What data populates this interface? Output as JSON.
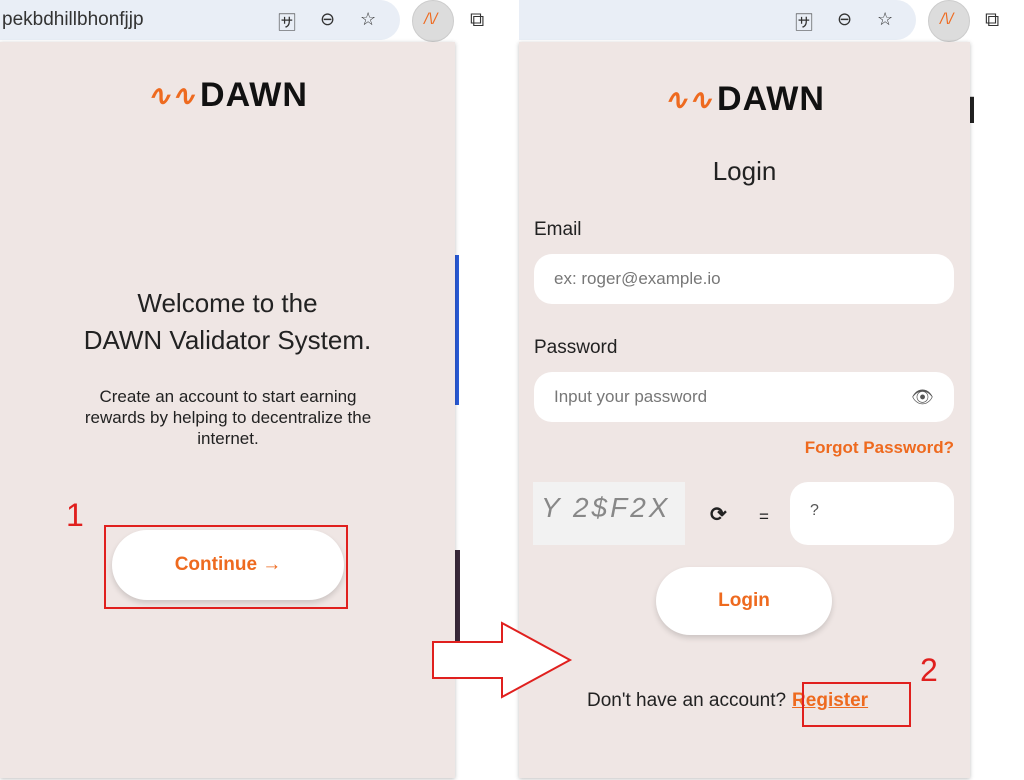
{
  "browser": {
    "url_fragment": "pekbdhillbhonfjjp",
    "icons": [
      "translate-icon",
      "zoom-out-icon",
      "star-icon",
      "dawn-extension-icon",
      "extensions-puzzle-icon"
    ]
  },
  "welcome": {
    "brand": "DAWN",
    "title_line1": "Welcome to the",
    "title_line2": "DAWN Validator System.",
    "description": "Create an account to start earning rewards by helping to decentralize the internet.",
    "continue_label": "Continue →"
  },
  "login": {
    "brand": "DAWN",
    "title": "Login",
    "email_label": "Email",
    "email_placeholder": "ex: roger@example.io",
    "password_label": "Password",
    "password_placeholder": "Input your password",
    "forgot_label": "Forgot Password?",
    "captcha_text": "Y 2$F2X",
    "equals": "=",
    "captcha_placeholder": "?",
    "login_label": "Login",
    "no_account_text": "Don't have an account?",
    "register_label": "Register"
  },
  "annotations": {
    "step1": "1",
    "step2": "2",
    "color": "#e0201e"
  },
  "colors": {
    "accent": "#ee6a1f",
    "popup_bg": "#efe6e4"
  }
}
